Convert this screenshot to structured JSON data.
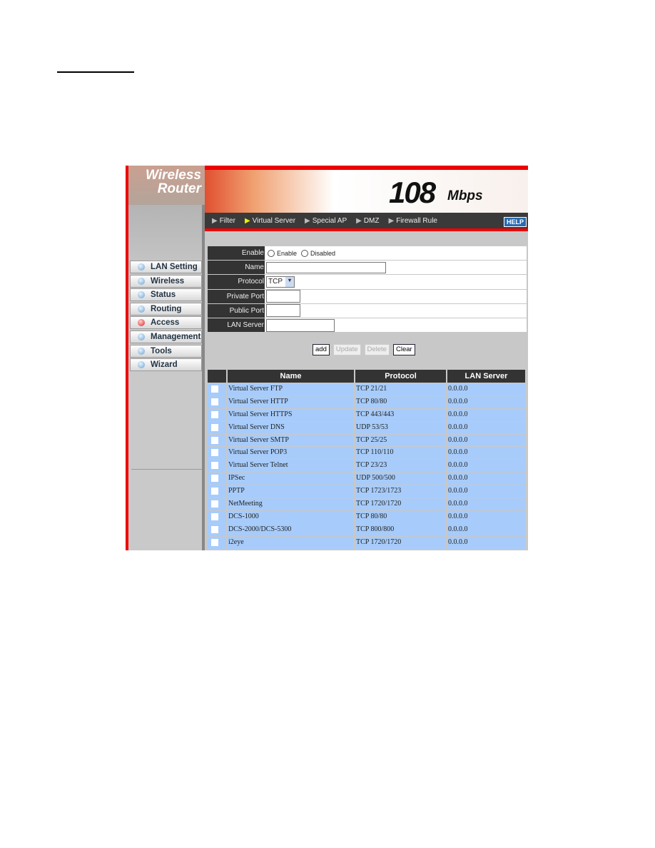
{
  "logo": {
    "line1": "Wireless",
    "line2": "Router"
  },
  "banner": {
    "speed": "108",
    "unit": "Mbps"
  },
  "nav": {
    "items": [
      {
        "label": "Filter"
      },
      {
        "label": "Virtual Server",
        "active": true
      },
      {
        "label": "Special AP"
      },
      {
        "label": "DMZ"
      },
      {
        "label": "Firewall Rule"
      }
    ],
    "help": "HELP"
  },
  "sidebar": {
    "items": [
      {
        "label": "LAN Setting"
      },
      {
        "label": "Wireless"
      },
      {
        "label": "Status"
      },
      {
        "label": "Routing"
      },
      {
        "label": "Access",
        "active": true
      },
      {
        "label": "Management"
      },
      {
        "label": "Tools"
      },
      {
        "label": "Wizard"
      }
    ]
  },
  "form": {
    "enable_label": "Enable",
    "enable_opt": "Enable",
    "disabled_opt": "Disabled",
    "name_label": "Name",
    "name_value": "",
    "protocol_label": "Protocol",
    "protocol_value": "TCP",
    "private_label": "Private Port",
    "private_value": "",
    "public_label": "Public Port",
    "public_value": "",
    "lan_label": "LAN Server",
    "lan_value": ""
  },
  "buttons": {
    "add": "add",
    "update": "Update",
    "delete": "Delete",
    "clear": "Clear"
  },
  "table": {
    "headers": [
      "",
      "Name",
      "Protocol",
      "LAN Server"
    ],
    "rows": [
      [
        "Virtual Server FTP",
        "TCP 21/21",
        "0.0.0.0"
      ],
      [
        "Virtual Server HTTP",
        "TCP 80/80",
        "0.0.0.0"
      ],
      [
        "Virtual Server HTTPS",
        "TCP 443/443",
        "0.0.0.0"
      ],
      [
        "Virtual Server DNS",
        "UDP 53/53",
        "0.0.0.0"
      ],
      [
        "Virtual Server SMTP",
        "TCP 25/25",
        "0.0.0.0"
      ],
      [
        "Virtual Server POP3",
        "TCP 110/110",
        "0.0.0.0"
      ],
      [
        "Virtual Server Telnet",
        "TCP 23/23",
        "0.0.0.0"
      ],
      [
        "IPSec",
        "UDP 500/500",
        "0.0.0.0"
      ],
      [
        "PPTP",
        "TCP 1723/1723",
        "0.0.0.0"
      ],
      [
        "NetMeeting",
        "TCP 1720/1720",
        "0.0.0.0"
      ],
      [
        "DCS-1000",
        "TCP 80/80",
        "0.0.0.0"
      ],
      [
        "DCS-2000/DCS-5300",
        "TCP 800/800",
        "0.0.0.0"
      ],
      [
        "i2eye",
        "TCP 1720/1720",
        "0.0.0.0"
      ]
    ]
  },
  "colors": {
    "accent": "#e00000",
    "row_bg": "#a7ccfb",
    "header_bg": "#333333"
  }
}
